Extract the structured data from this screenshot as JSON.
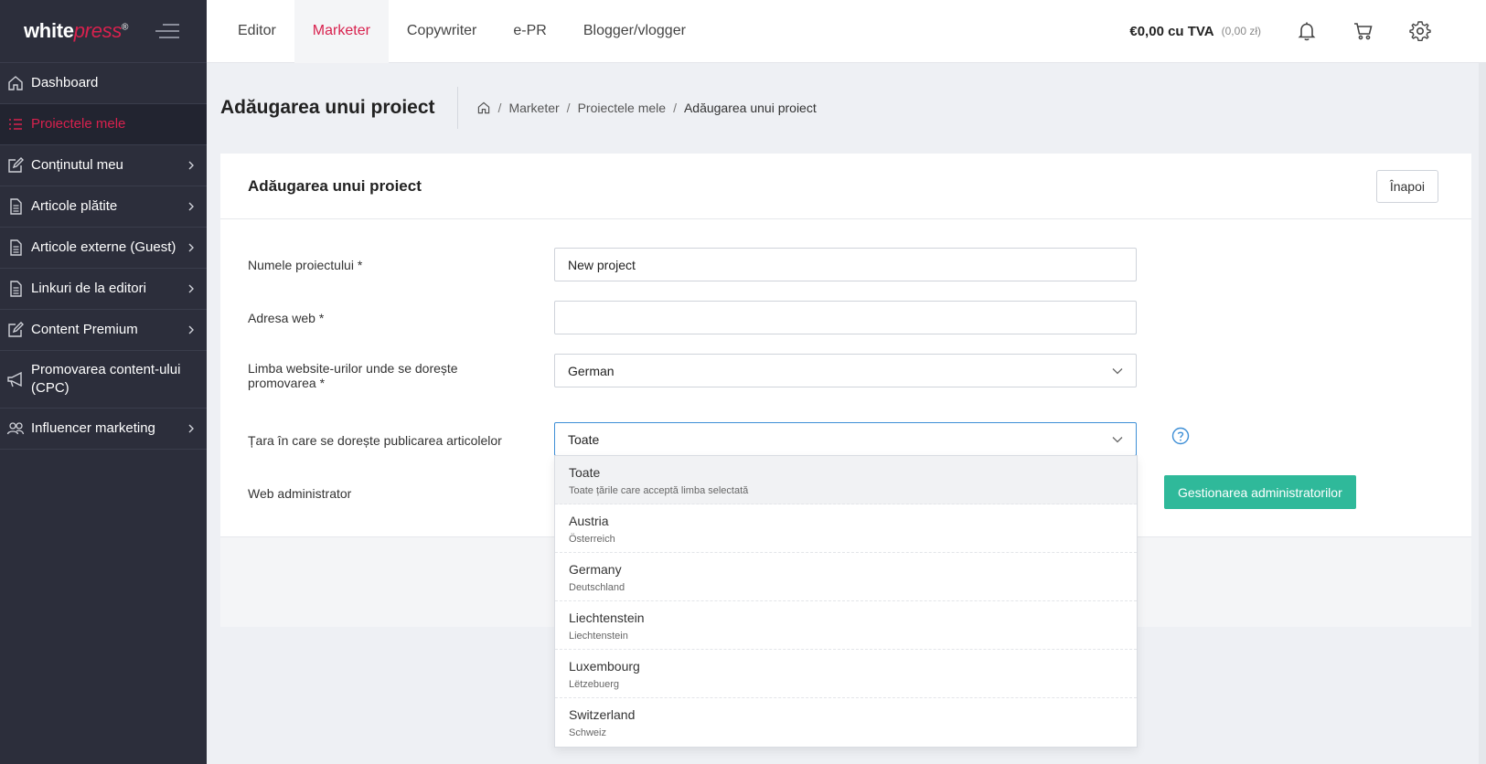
{
  "logo": {
    "white": "white",
    "press": "press",
    "mark": "®"
  },
  "sidebar": {
    "items": [
      {
        "label": "Dashboard",
        "icon": "home-icon",
        "chevron": false
      },
      {
        "label": "Proiectele mele",
        "icon": "list-icon",
        "chevron": false,
        "active": true
      },
      {
        "label": "Conținutul meu",
        "icon": "edit-icon",
        "chevron": true
      },
      {
        "label": "Articole plătite",
        "icon": "document-icon",
        "chevron": true
      },
      {
        "label": "Articole externe (Guest)",
        "icon": "document-icon",
        "chevron": true
      },
      {
        "label": "Linkuri de la editori",
        "icon": "document-icon",
        "chevron": true
      },
      {
        "label": "Content Premium",
        "icon": "edit-icon",
        "chevron": true
      },
      {
        "label": "Promovarea content-ului (CPC)",
        "icon": "megaphone-icon",
        "chevron": false
      },
      {
        "label": "Influencer marketing",
        "icon": "users-icon",
        "chevron": true
      }
    ]
  },
  "topbar": {
    "tabs": [
      "Editor",
      "Marketer",
      "Copywriter",
      "e-PR",
      "Blogger/vlogger"
    ],
    "active_tab": "Marketer",
    "balance": "€0,00 cu TVA",
    "balance_sub": "(0,00 zł)"
  },
  "page": {
    "title": "Adăugarea unui proiect",
    "breadcrumb": [
      "Marketer",
      "Proiectele mele",
      "Adăugarea unui proiect"
    ]
  },
  "card": {
    "title": "Adăugarea unui proiect",
    "back_label": "Înapoi"
  },
  "form": {
    "project_name_label": "Numele proiectului *",
    "project_name_value": "New project",
    "web_address_label": "Adresa web *",
    "web_address_value": "",
    "language_label": "Limba website-urilor unde se dorește promovarea *",
    "language_value": "German",
    "country_label": "Țara în care se dorește publicarea articolelor",
    "country_value": "Toate",
    "admin_label": "Web administrator",
    "manage_admins_label": "Gestionarea administratorilor"
  },
  "dropdown": {
    "options": [
      {
        "name": "Toate",
        "sub": "Toate țările care acceptă limba selectată"
      },
      {
        "name": "Austria",
        "sub": "Österreich"
      },
      {
        "name": "Germany",
        "sub": "Deutschland"
      },
      {
        "name": "Liechtenstein",
        "sub": "Liechtenstein"
      },
      {
        "name": "Luxembourg",
        "sub": "Lëtzebuerg"
      },
      {
        "name": "Switzerland",
        "sub": "Schweiz"
      }
    ]
  },
  "colors": {
    "sidebar_bg": "#2c2e3b",
    "accent_red": "#d8214e",
    "accent_green": "#2fb99a",
    "focus_blue": "#3e8fd6"
  }
}
